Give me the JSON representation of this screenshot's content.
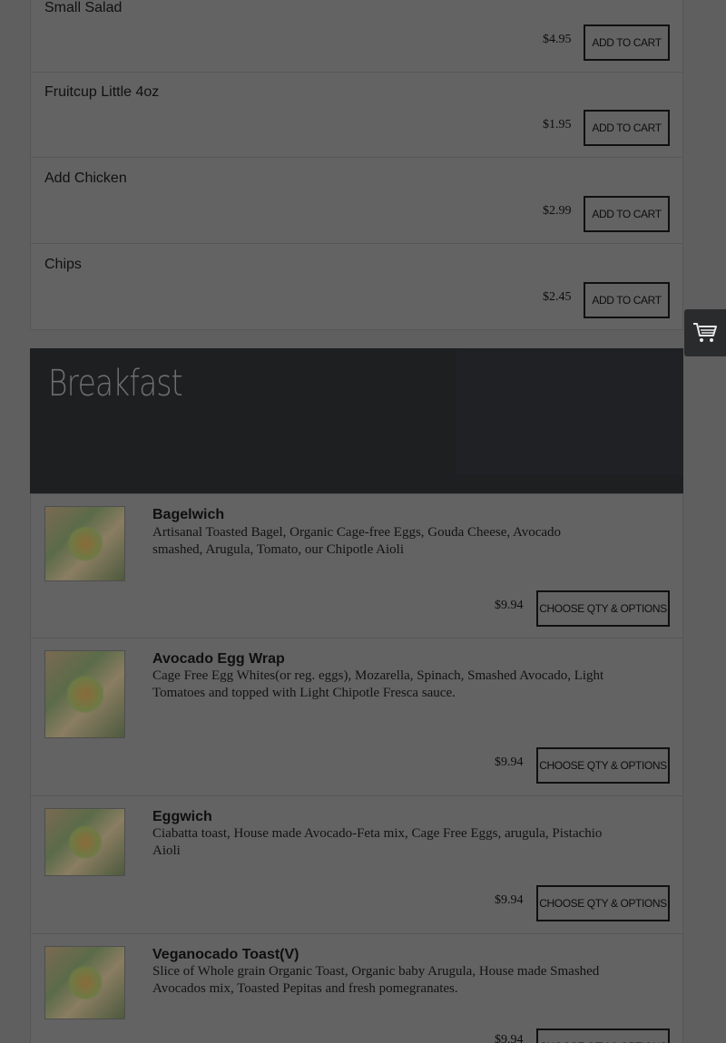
{
  "addons": [
    {
      "name": "Small Salad",
      "price": "$4.95",
      "button": "ADD TO CART"
    },
    {
      "name": "Fruitcup Little 4oz",
      "price": "$1.95",
      "button": "ADD TO CART"
    },
    {
      "name": "Add Chicken",
      "price": "$2.99",
      "button": "ADD TO CART"
    },
    {
      "name": "Chips",
      "price": "$2.45",
      "button": "ADD TO CART"
    }
  ],
  "section": {
    "title": "Breakfast"
  },
  "items": [
    {
      "name": "Bagelwich",
      "desc": "Artisanal Toasted Bagel, Organic Cage-free Eggs, Gouda Cheese, Avocado smashed, Arugula, Tomato, our Chipotle Aioli",
      "price": "$9.94",
      "button": "CHOOSE QTY & OPTIONS"
    },
    {
      "name": "Avocado Egg Wrap",
      "desc": "Cage Free Egg Whites(or reg. eggs), Mozarella, Spinach, Smashed Avocado, Light Tomatoes and topped with Light Chipotle Fresca sauce.",
      "price": "$9.94",
      "button": "CHOOSE QTY & OPTIONS"
    },
    {
      "name": "Eggwich",
      "desc": "Ciabatta toast, House made Avocado-Feta mix, Cage Free Eggs, arugula, Pistachio Aioli",
      "price": "$9.94",
      "button": "CHOOSE QTY & OPTIONS"
    },
    {
      "name": "Veganocado Toast(V)",
      "desc": "Slice of Whole grain Organic Toast, Organic baby Arugula, House made Smashed Avocados mix, Toasted Pepitas and fresh pomegranates.",
      "price": "$9.94",
      "button": "CHOOSE QTY & OPTIONS"
    }
  ],
  "icons": {
    "cart": "shopping-cart-icon"
  }
}
